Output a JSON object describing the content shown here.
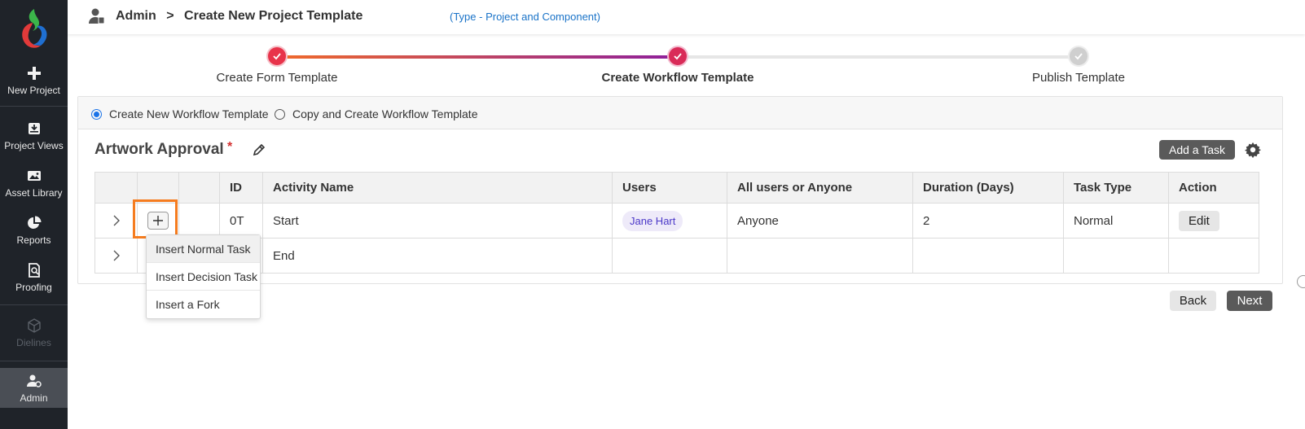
{
  "sidebar": {
    "items": [
      {
        "label": "New Project",
        "icon": "plus-icon"
      },
      {
        "label": "Project Views",
        "icon": "tray-icon"
      },
      {
        "label": "Asset Library",
        "icon": "image-icon"
      },
      {
        "label": "Reports",
        "icon": "pie-chart-icon"
      },
      {
        "label": "Proofing",
        "icon": "magnify-doc-icon"
      },
      {
        "label": "Dielines",
        "icon": "box-icon",
        "disabled": true
      },
      {
        "label": "Admin",
        "icon": "admin-user-icon",
        "active": true
      }
    ]
  },
  "header": {
    "section": "Admin",
    "separator": ">",
    "title": "Create New Project Template",
    "type_note": "(Type - Project and Component)"
  },
  "stepper": {
    "steps": [
      {
        "label": "Create Form Template",
        "status": "done"
      },
      {
        "label": "Create Workflow Template",
        "status": "current"
      },
      {
        "label": "Publish Template",
        "status": "pending"
      }
    ]
  },
  "options": {
    "create_new": "Create New Workflow Template",
    "copy_create": "Copy and Create Workflow Template",
    "selected": "create_new"
  },
  "workflow": {
    "name": "Artwork Approval",
    "required_mark": "*",
    "add_task_label": "Add a Task"
  },
  "table": {
    "columns": [
      "",
      "",
      "",
      "ID",
      "Activity Name",
      "Users",
      "All users or Anyone",
      "Duration (Days)",
      "Task Type",
      "Action"
    ],
    "rows": [
      {
        "id": "0T",
        "activity": "Start",
        "user": "Jane Hart",
        "all_or_anyone": "Anyone",
        "duration": "2",
        "task_type": "Normal",
        "action": "Edit"
      },
      {
        "id": "",
        "activity": "End",
        "user": "",
        "all_or_anyone": "",
        "duration": "",
        "task_type": "",
        "action": ""
      }
    ]
  },
  "insert_menu": {
    "items": [
      "Insert Normal Task",
      "Insert Decision Task",
      "Insert a Fork"
    ]
  },
  "footer": {
    "back_label": "Back",
    "next_label": "Next"
  },
  "colors": {
    "sidebar_bg": "#1f2329",
    "accent_link": "#1a73c8",
    "step_done": "#e8334a",
    "gradient_start": "#f06a2a",
    "gradient_end": "#8e1f9c",
    "highlight": "#f57c1f",
    "chip_bg": "#eeeaf9",
    "chip_text": "#4b38c8"
  }
}
